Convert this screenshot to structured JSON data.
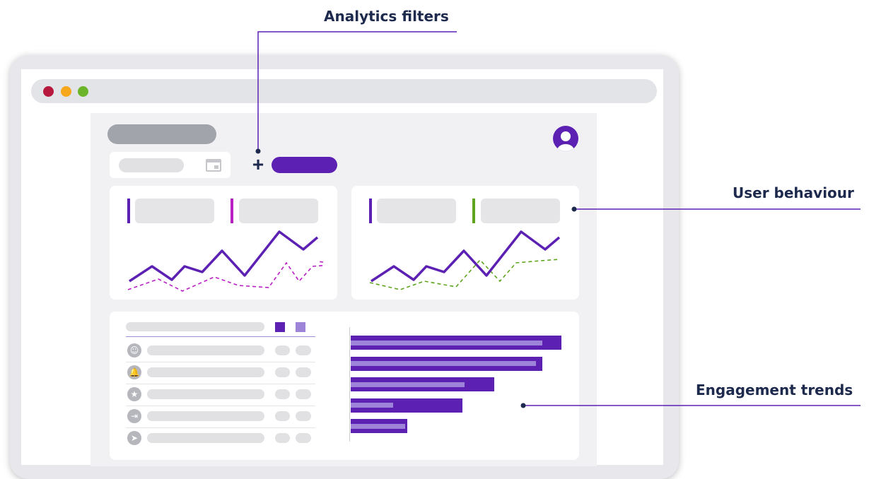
{
  "callouts": {
    "analytics_filters": "Analytics filters",
    "user_behaviour": "User behaviour",
    "engagement_trends": "Engagement trends"
  },
  "icons": {
    "add": "+",
    "list_row_icons": [
      "smile-icon",
      "bell-icon",
      "star-icon",
      "export-icon",
      "send-icon"
    ]
  },
  "colors": {
    "purple": "#5c21b3",
    "light_purple": "#9d84d8",
    "magenta": "#b81fc4",
    "green": "#5ea51d",
    "callout_line": "#5c21b3",
    "traffic_red": "#b7193e",
    "traffic_orange": "#f6a71b",
    "traffic_green": "#6cb52a"
  },
  "engagement_bars": {
    "outer": [
      1.0,
      0.91,
      0.68,
      0.53,
      0.27
    ],
    "inner": [
      0.91,
      0.88,
      0.54,
      0.2,
      0.26
    ]
  }
}
